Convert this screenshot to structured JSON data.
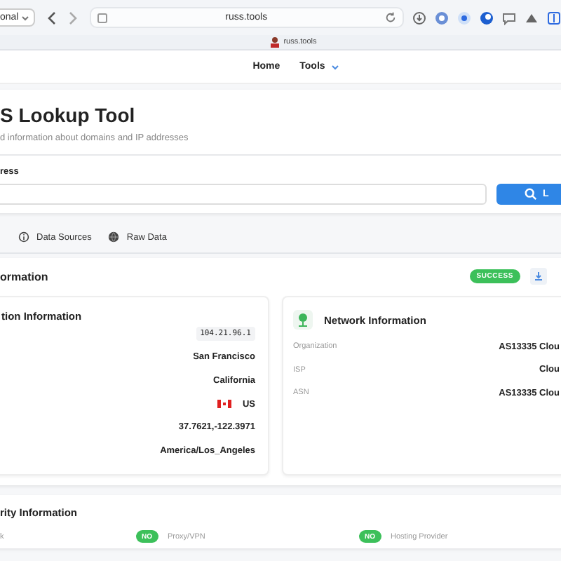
{
  "browser": {
    "profile_menu": "onal",
    "url": "russ.tools",
    "tab_title": "russ.tools"
  },
  "nav": [
    {
      "label": "Home",
      "dropdown": false
    },
    {
      "label": "Tools",
      "dropdown": true
    }
  ],
  "header": {
    "title": "S Lookup Tool",
    "subtitle": "d information about domains and IP addresses"
  },
  "search": {
    "label": "ress",
    "button": "L"
  },
  "tabs": [
    {
      "label": "Data Sources",
      "selected": false
    },
    {
      "label": "Raw Data",
      "selected": false
    }
  ],
  "results": {
    "title": "ormation",
    "status": "SUCCESS"
  },
  "location": {
    "title": "tion Information",
    "rows": [
      {
        "kind": "code",
        "value": "104.21.96.1"
      },
      {
        "kind": "text",
        "value": "San Francisco"
      },
      {
        "kind": "text",
        "value": "California"
      },
      {
        "kind": "flag",
        "value": "US"
      },
      {
        "kind": "text",
        "value": "37.7621,-122.3971"
      },
      {
        "kind": "text",
        "value": "America/Los_Angeles"
      }
    ]
  },
  "network": {
    "title": "Network Information",
    "rows": [
      {
        "label": "Organization",
        "value": "AS13335 Clou"
      },
      {
        "label": "ISP",
        "value": "Clou"
      },
      {
        "label": "ASN",
        "value": "AS13335 Clou"
      }
    ]
  },
  "security": {
    "title": "rity Information",
    "items": [
      {
        "label": "k"
      },
      {
        "status": "NO",
        "label": "Proxy/VPN"
      },
      {
        "status": "NO",
        "label": "Hosting Provider"
      }
    ]
  }
}
